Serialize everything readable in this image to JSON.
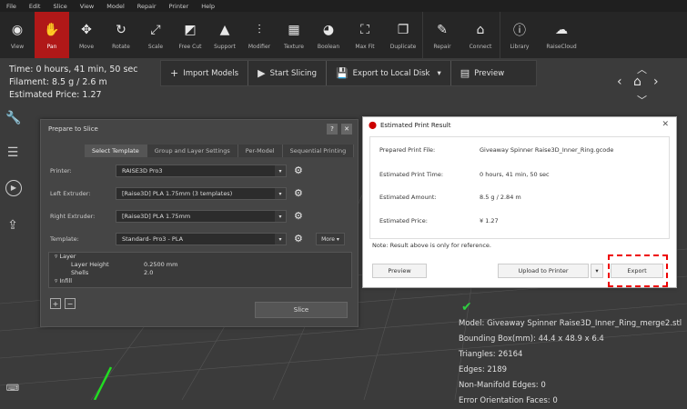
{
  "menu": [
    "File",
    "Edit",
    "Slice",
    "View",
    "Model",
    "Repair",
    "Printer",
    "Help"
  ],
  "toolbar": [
    {
      "label": "View",
      "icon": "eye-icon"
    },
    {
      "label": "Pan",
      "icon": "hand-icon",
      "active": true
    },
    {
      "label": "Move",
      "icon": "move-icon"
    },
    {
      "label": "Rotate",
      "icon": "rotate-icon"
    },
    {
      "label": "Scale",
      "icon": "scale-icon"
    },
    {
      "label": "Free Cut",
      "icon": "cut-icon"
    },
    {
      "label": "Support",
      "icon": "support-icon"
    },
    {
      "label": "Modifier",
      "icon": "modifier-icon"
    },
    {
      "label": "Texture",
      "icon": "texture-icon"
    },
    {
      "label": "Boolean",
      "icon": "boolean-icon"
    },
    {
      "label": "Max Fit",
      "icon": "maxfit-icon"
    },
    {
      "label": "Duplicate",
      "icon": "duplicate-icon"
    },
    {
      "label": "Repair",
      "icon": "repair-icon"
    },
    {
      "label": "Connect",
      "icon": "connect-icon"
    },
    {
      "label": "Library",
      "icon": "library-icon"
    },
    {
      "label": "RaiseCloud",
      "icon": "cloud-icon"
    }
  ],
  "info": {
    "time": "Time: 0 hours, 41 min, 50 sec",
    "filament": "Filament: 8.5 g / 2.6 m",
    "price": "Estimated Price: 1.27"
  },
  "actions": {
    "import": "Import Models",
    "start": "Start Slicing",
    "export": "Export to Local Disk",
    "preview": "Preview"
  },
  "slice_dialog": {
    "title": "Prepare to Slice",
    "tabs": [
      "Select Template",
      "Group and Layer Settings",
      "Per-Model",
      "Sequential Printing"
    ],
    "printer_label": "Printer:",
    "printer_value": "RAISE3D Pro3",
    "left_label": "Left Extruder:",
    "left_value": "[Raise3D] PLA 1.75mm (3 templates)",
    "right_label": "Right Extruder:",
    "right_value": "[Raise3D] PLA 1.75mm",
    "template_label": "Template:",
    "template_value": "Standard- Pro3 - PLA",
    "more": "More",
    "params": {
      "layer": "Layer",
      "layer_height_label": "Layer Height",
      "layer_height_value": "0.2500 mm",
      "shells_label": "Shells",
      "shells_value": "2.0",
      "infill": "Infill"
    },
    "slice_button": "Slice"
  },
  "estimate": {
    "title": "Estimated Print Result",
    "file_label": "Prepared Print File:",
    "file_value": "Giveaway Spinner Raise3D_Inner_Ring.gcode",
    "time_label": "Estimated Print Time:",
    "time_value": "0 hours, 41 min, 50 sec",
    "amount_label": "Estimated Amount:",
    "amount_value": "8.5 g / 2.84 m",
    "price_label": "Estimated Price:",
    "price_value": "¥ 1.27",
    "note": "Note: Result above is only for reference.",
    "preview": "Preview",
    "upload": "Upload to Printer",
    "export": "Export"
  },
  "model_info": [
    "Model: Giveaway Spinner Raise3D_Inner_Ring_merge2.stl",
    "Bounding Box(mm): 44.4 x 48.9 x 6.4",
    "Triangles: 26164",
    "Edges: 2189",
    "Non-Manifold Edges: 0",
    "Error Orientation Faces: 0"
  ],
  "colors": {
    "accent": "#b01818",
    "highlight": "#e00000",
    "ok": "#2ecc40"
  }
}
